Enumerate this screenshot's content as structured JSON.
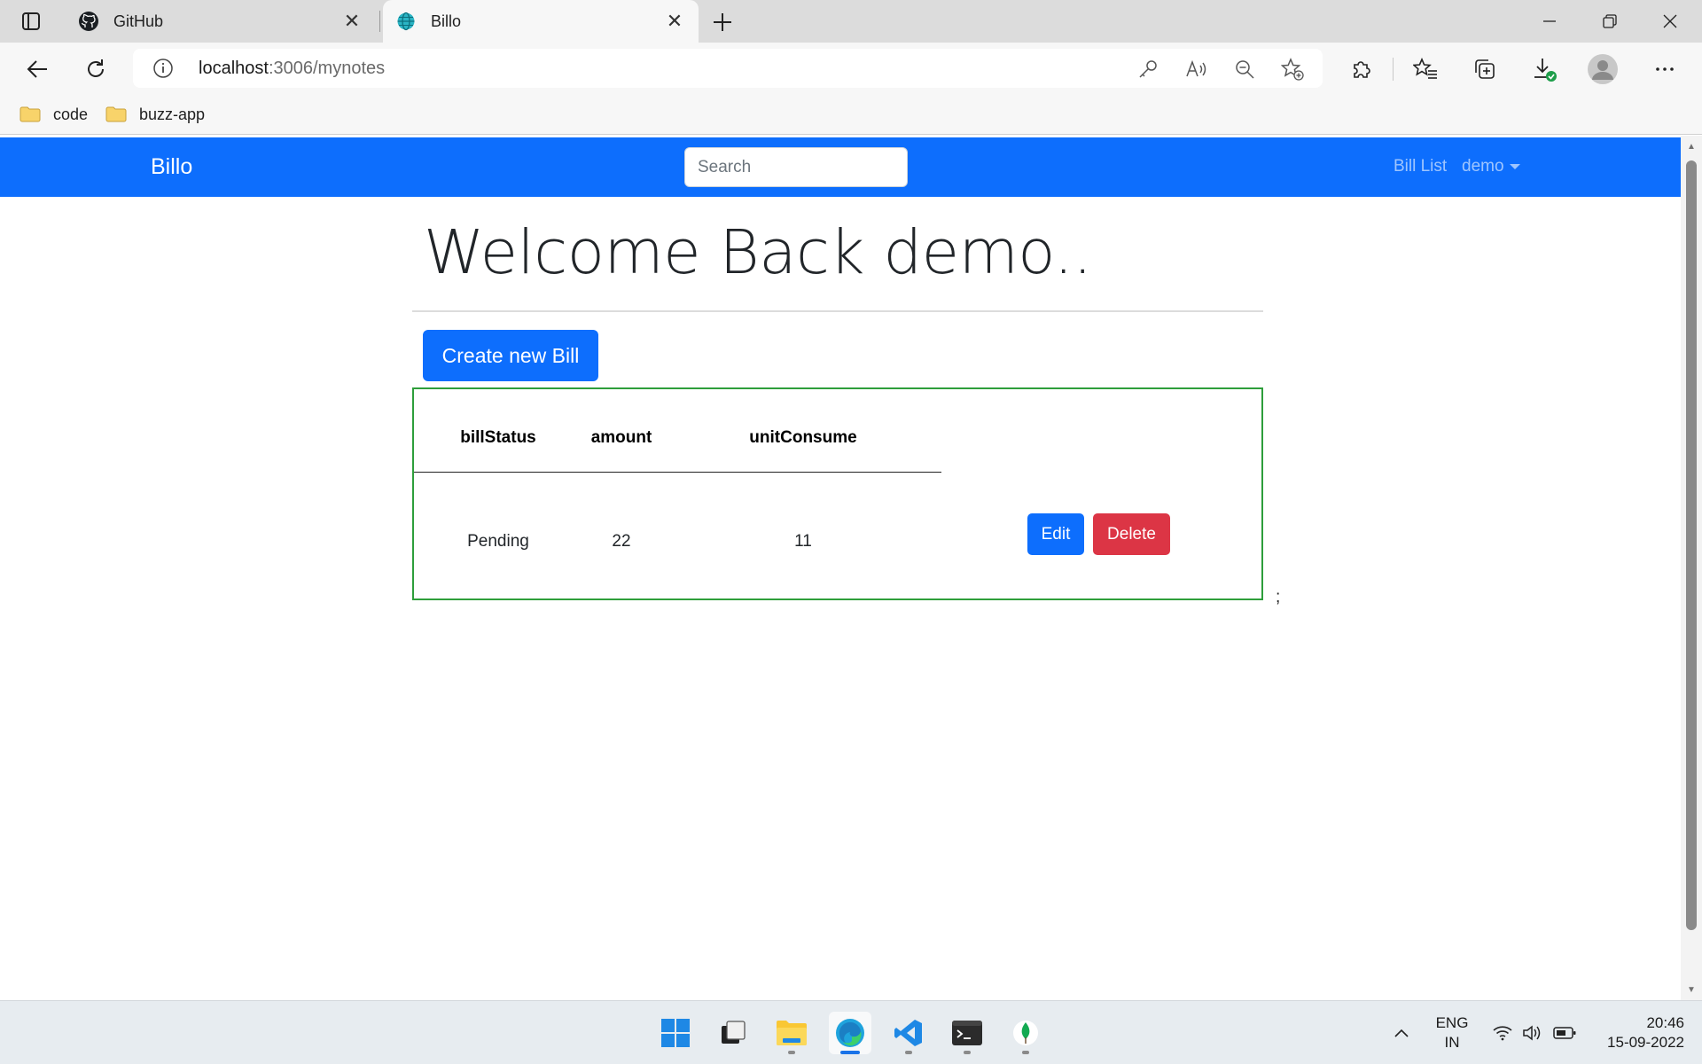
{
  "browser": {
    "tabs": [
      {
        "title": "GitHub",
        "icon": "github-icon",
        "active": false
      },
      {
        "title": "Billo",
        "icon": "globe-icon",
        "active": true
      }
    ],
    "address": {
      "host": "localhost",
      "path": ":3006/mynotes"
    },
    "bookmarks": [
      {
        "label": "code",
        "icon": "folder-icon"
      },
      {
        "label": "buzz-app",
        "icon": "folder-icon"
      }
    ]
  },
  "navbar": {
    "brand": "Billo",
    "search_placeholder": "Search",
    "bill_list": "Bill List",
    "user": "demo"
  },
  "main": {
    "welcome": "Welcome Back demo..",
    "create_button": "Create new Bill",
    "stray_text": ";"
  },
  "table": {
    "headers": [
      "billStatus",
      "amount",
      "unitConsume"
    ],
    "rows": [
      {
        "billStatus": "Pending",
        "amount": "22",
        "unitConsume": "11"
      }
    ],
    "edit_label": "Edit",
    "delete_label": "Delete"
  },
  "taskbar": {
    "apps": [
      "windows-start-icon",
      "task-view-icon",
      "file-explorer-icon",
      "edge-icon",
      "vscode-icon",
      "terminal-icon",
      "mongodb-icon"
    ],
    "lang_line1": "ENG",
    "lang_line2": "IN",
    "time": "20:46",
    "date": "15-09-2022"
  },
  "colors": {
    "primary": "#0d6efd",
    "danger": "#dc3545",
    "bill_border": "#2e9e3b"
  }
}
